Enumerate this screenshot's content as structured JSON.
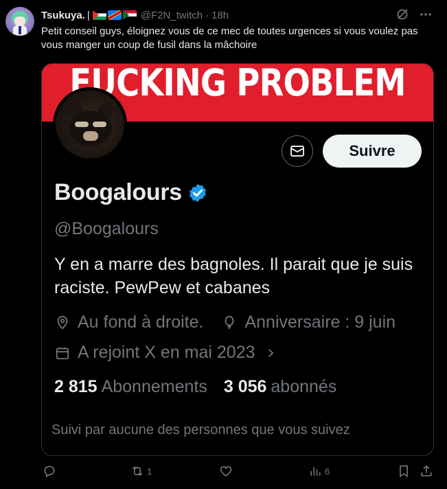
{
  "tweet": {
    "author_name": "Tsukuya.",
    "name_separator": "|",
    "flags": [
      "palestine-flag",
      "drc-flag",
      "sudan-flag"
    ],
    "handle": "@F2N_twitch",
    "time": "18h",
    "text": "Petit conseil guys, éloignez vous de ce mec de toutes urgences si vous voulez pas vous manger un coup de fusil dans la mâchoire"
  },
  "card": {
    "banner_text": "FUCKING PROBLEM",
    "follow_label": "Suivre",
    "display_name": "Boogalours",
    "handle": "@Boogalours",
    "bio": "Y en a marre des bagnoles. Il parait que je suis raciste. PewPew et cabanes",
    "location": "Au fond à droite.",
    "birthday": "Anniversaire : 9 juin",
    "joined": "A rejoint X en mai 2023",
    "following_count": "2 815",
    "following_label": "Abonnements",
    "followers_count": "3 056",
    "followers_label": "abonnés",
    "followed_by": "Suivi par aucune des personnes que vous suivez",
    "accent_color": "#1d9bf0",
    "banner_color": "#e01e2c"
  },
  "actions": {
    "replies": "",
    "reposts": "1",
    "likes": "",
    "views": "6"
  }
}
